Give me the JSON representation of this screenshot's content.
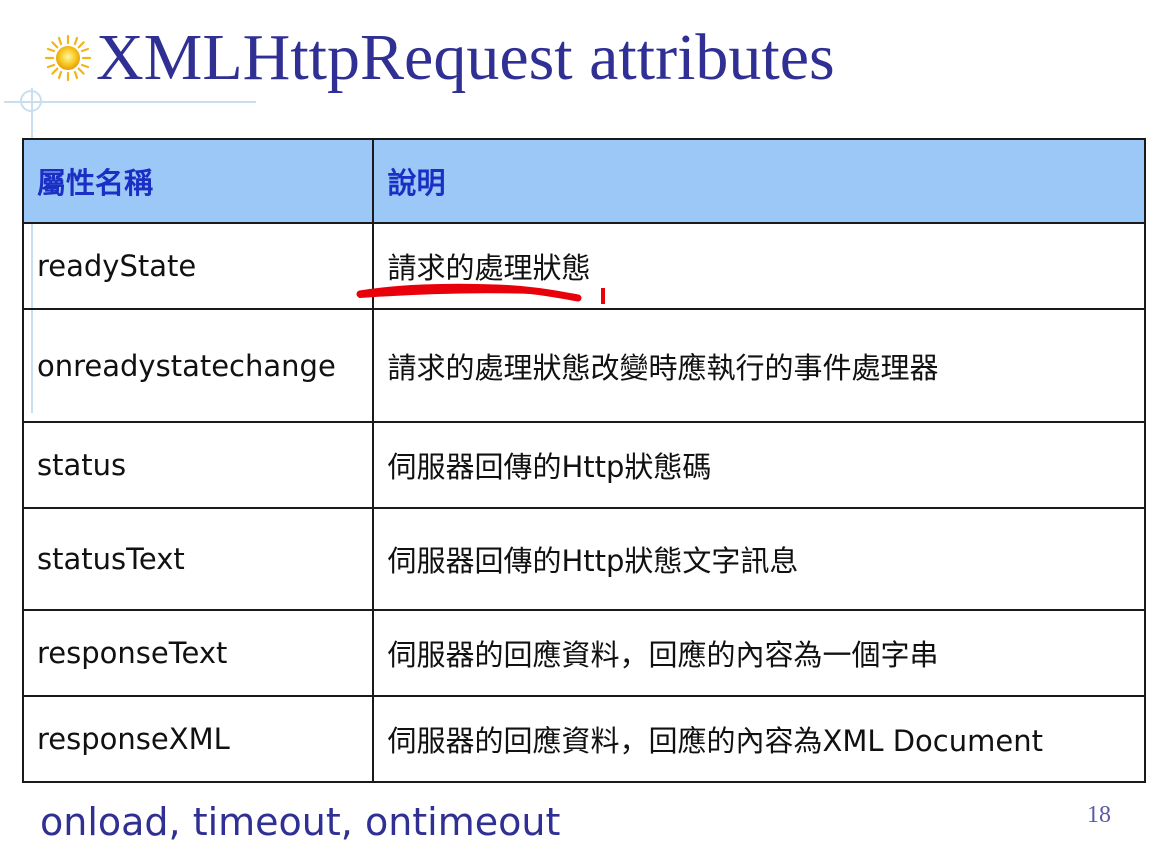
{
  "title": "XMLHttpRequest attributes",
  "table": {
    "headers": [
      "屬性名稱",
      "說明"
    ],
    "rows": [
      {
        "name": "readyState",
        "description": "請求的處理狀態"
      },
      {
        "name": "onreadystatechange",
        "description": "請求的處理狀態改變時應執行的事件處理器"
      },
      {
        "name": "status",
        "description": "伺服器回傳的Http狀態碼"
      },
      {
        "name": "statusText",
        "description": "伺服器回傳的Http狀態文字訊息"
      },
      {
        "name": "responseText",
        "description": "伺服器的回應資料，回應的內容為一個字串"
      },
      {
        "name": "responseXML",
        "description": "伺服器的回應資料，回應的內容為XML Document"
      }
    ]
  },
  "footer": "onload, timeout, ontimeout",
  "page_number": "18",
  "colors": {
    "title": "#2f2f94",
    "header_bg": "#9cc8f7",
    "header_text": "#1b2fc4",
    "annotation": "#e8000b"
  },
  "icons": {
    "bullet": "sun-icon"
  }
}
